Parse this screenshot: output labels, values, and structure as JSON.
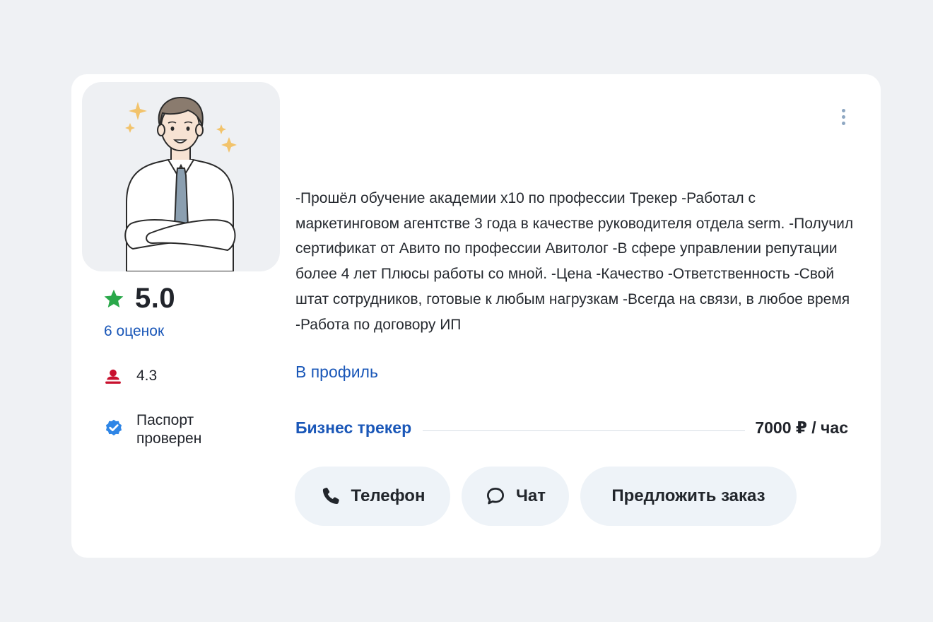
{
  "rating": {
    "value": "5.0",
    "reviews_label": "6 оценок",
    "secondary_value": "4.3",
    "passport_line1": "Паспорт",
    "passport_line2": "проверен"
  },
  "description": "-Прошёл обучение академии x10 по профессии Трекер -Работал с маркетинговом агентстве 3 года в качестве руководителя отдела serm. -Получил сертификат от Авито по профессии Авитолог -В сфере управлении репутации более 4 лет Плюсы работы со мной. -Цена -Качество -Ответственность -Свой штат сотрудников, готовые к любым нагрузкам -Всегда на связи, в любое время -Работа по договору ИП",
  "profile_link": "В профиль",
  "service": {
    "name": "Бизнес трекер",
    "price": "7000 ₽ / час"
  },
  "buttons": {
    "phone": "Телефон",
    "chat": "Чат",
    "order": "Предложить заказ"
  },
  "icons": {
    "rating": "star-icon",
    "secondary": "person-icon",
    "passport": "verified-badge-icon",
    "phone": "phone-icon",
    "chat": "chat-bubble-icon",
    "menu": "more-vertical-icon"
  },
  "colors": {
    "background": "#eff1f4",
    "card": "#ffffff",
    "accent_blue": "#1a57b8",
    "star_green": "#2aa84a",
    "person_red": "#c8102e",
    "verified_blue": "#2f86e6",
    "button_bg": "#eef3f8"
  }
}
